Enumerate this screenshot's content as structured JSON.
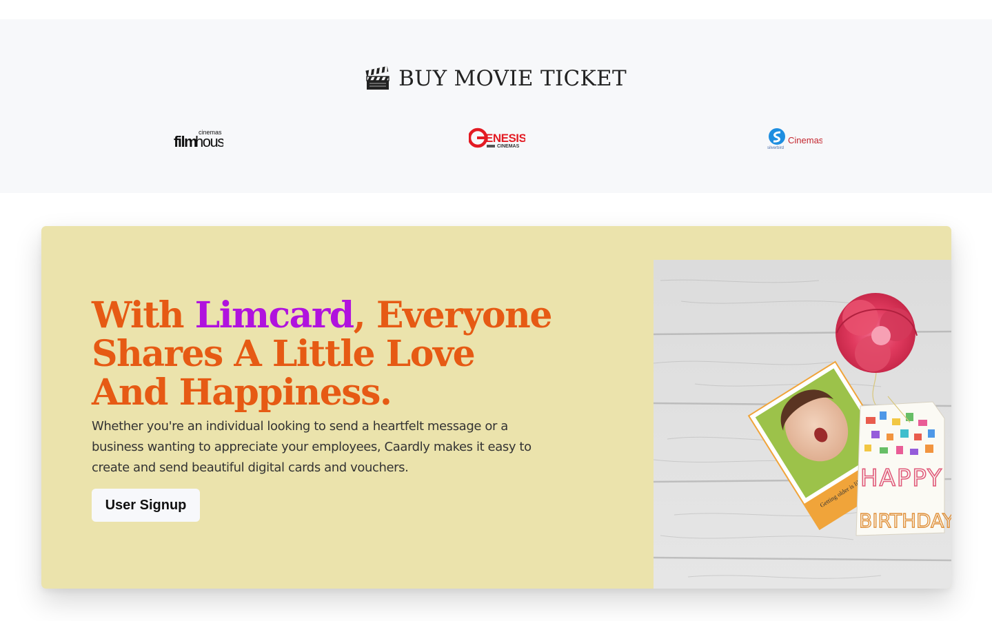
{
  "ticket_section": {
    "title": "BUY MOVIE TICKET",
    "icon": "clapperboard-icon",
    "partners": [
      {
        "name": "filmhouse cinemas",
        "word1": "film",
        "word2": "house",
        "tag": "cinemas"
      },
      {
        "name": "Genesis Cinemas",
        "word": "ENESIS",
        "tag": "CINEMAS"
      },
      {
        "name": "silverbird Cinemas",
        "word": "Cinemas",
        "tag": "silverbird"
      }
    ]
  },
  "promo": {
    "headline_prefix": "With ",
    "headline_brand": "Limcard",
    "headline_rest": ", Everyone Shares A Little Love And Happiness.",
    "description": "Whether you're an individual looking to send a heartfelt message or a business wanting to appreciate your employees, Caardly makes it easy to create and send beautiful digital cards and vouchers.",
    "cta_label": "User Signup",
    "image": {
      "card_text": "Getting older is like",
      "happy": "HAPPY",
      "birthday": "BIRTHDAY"
    },
    "colors": {
      "background": "#ebe3ac",
      "headline": "#e65a14",
      "brand": "#b012de"
    }
  }
}
